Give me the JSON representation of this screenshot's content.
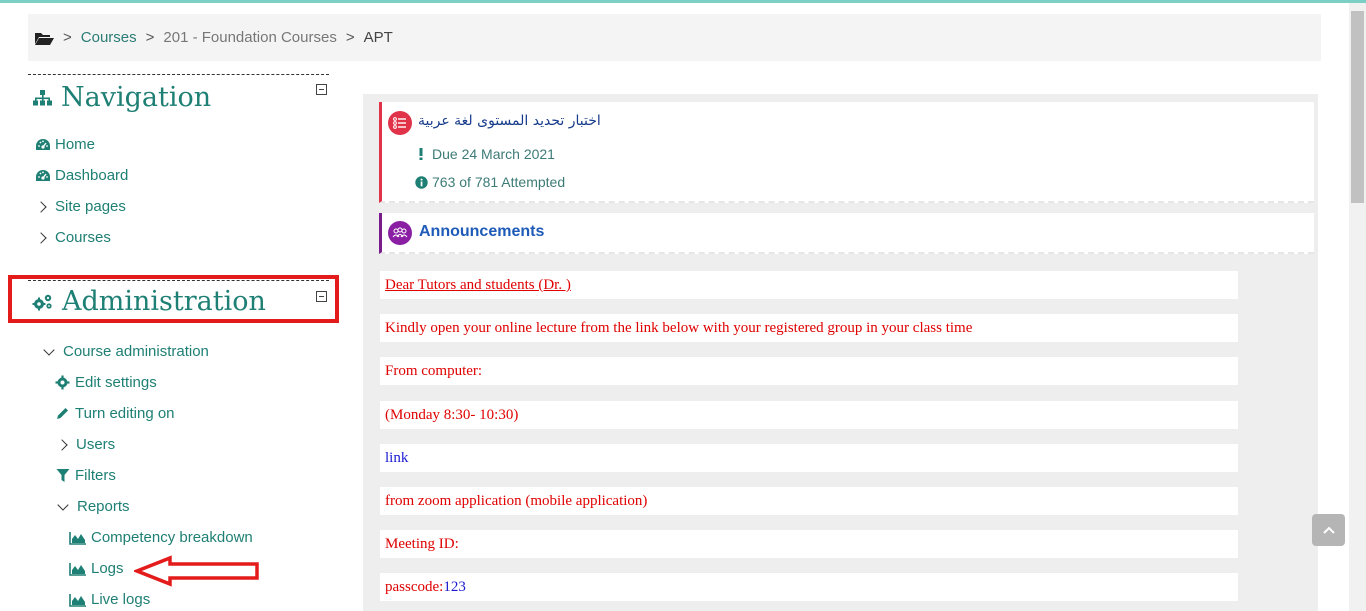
{
  "breadcrumb": {
    "home_icon": "folder-open-icon",
    "items": [
      "Courses",
      "201 - Foundation Courses",
      "APT"
    ],
    "separator": ">"
  },
  "navigation": {
    "title": "Navigation",
    "items": [
      {
        "label": "Home",
        "icon": "dashboard-icon"
      },
      {
        "label": "Dashboard",
        "icon": "dashboard-icon"
      },
      {
        "label": "Site pages",
        "icon": "chevron-right-icon"
      },
      {
        "label": "Courses",
        "icon": "chevron-right-icon"
      }
    ]
  },
  "administration": {
    "title": "Administration",
    "course_admin": "Course administration",
    "items": [
      {
        "label": "Edit settings",
        "icon": "gear-icon"
      },
      {
        "label": "Turn editing on",
        "icon": "pencil-icon"
      },
      {
        "label": "Users",
        "icon": "chevron-right-icon"
      },
      {
        "label": "Filters",
        "icon": "filter-icon"
      },
      {
        "label": "Reports",
        "icon": "chevron-down-icon"
      }
    ],
    "reports": [
      {
        "label": "Competency breakdown",
        "icon": "area-chart-icon"
      },
      {
        "label": "Logs",
        "icon": "area-chart-icon"
      },
      {
        "label": "Live logs",
        "icon": "area-chart-icon"
      }
    ]
  },
  "activity": {
    "title": "اختبار تحديد المستوى لغة عربية",
    "due": "Due 24 March 2021",
    "attempted": "763 of 781 Attempted",
    "accent": "#e0334a"
  },
  "announcements": {
    "title": "Announcements",
    "accent": "#8a1fa3",
    "lines": [
      "Dear Tutors and students (Dr. )",
      "Kindly open your online lecture from the link below with your registered group in your class time",
      "From computer:",
      "(Monday 8:30- 10:30)",
      "link",
      "from zoom application (mobile application)",
      "Meeting ID:",
      "passcode:",
      "123"
    ]
  },
  "colors": {
    "brand": "#1e7f74",
    "highlight": "#e31b1b"
  }
}
